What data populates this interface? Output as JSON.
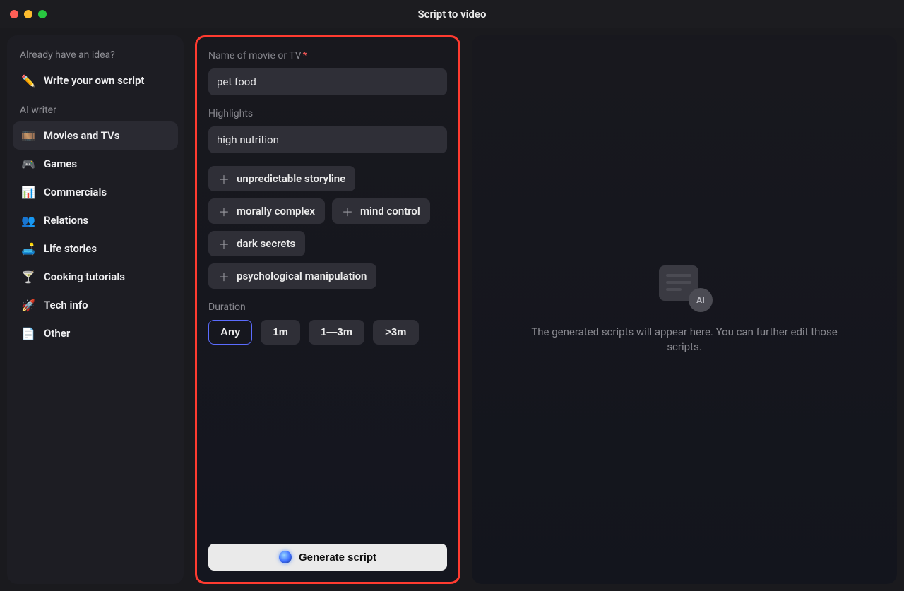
{
  "window": {
    "title": "Script to video"
  },
  "sidebar": {
    "idea_label": "Already have an idea?",
    "write_own": "Write your own script",
    "ai_writer_label": "AI writer",
    "items": [
      {
        "label": "Movies and TVs",
        "icon": "🎞️",
        "active": true
      },
      {
        "label": "Games",
        "icon": "🎮",
        "active": false
      },
      {
        "label": "Commercials",
        "icon": "📊",
        "active": false
      },
      {
        "label": "Relations",
        "icon": "👥",
        "active": false
      },
      {
        "label": "Life stories",
        "icon": "🛋️",
        "active": false
      },
      {
        "label": "Cooking tutorials",
        "icon": "🍸",
        "active": false
      },
      {
        "label": "Tech info",
        "icon": "🚀",
        "active": false
      },
      {
        "label": "Other",
        "icon": "📄",
        "active": false
      }
    ]
  },
  "form": {
    "name_label": "Name of movie or TV",
    "name_required": "*",
    "name_value": "pet food",
    "highlights_label": "Highlights",
    "highlights_value": "high nutrition",
    "suggestion_chips": [
      "unpredictable storyline",
      "morally complex",
      "mind control",
      "dark secrets",
      "psychological manipulation"
    ],
    "duration_label": "Duration",
    "duration_options": [
      "Any",
      "1m",
      "1—3m",
      ">3m"
    ],
    "duration_selected": "Any",
    "generate_label": "Generate script"
  },
  "preview": {
    "ai_badge": "AI",
    "placeholder_text": "The generated scripts will appear here. You can further edit those scripts."
  }
}
